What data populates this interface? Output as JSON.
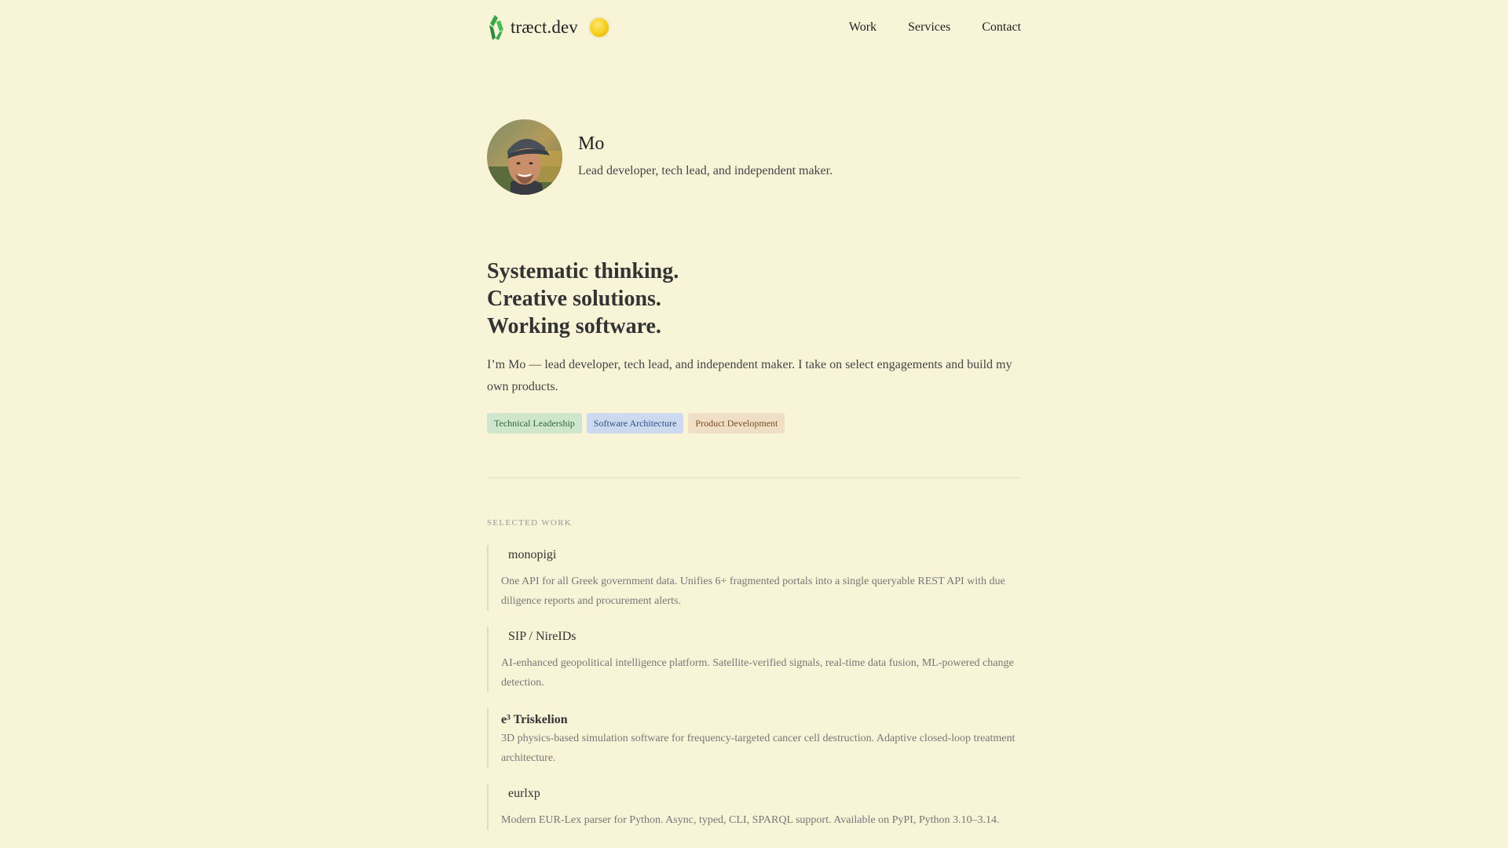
{
  "header": {
    "brand_name": "træct.dev",
    "nav": [
      "Work",
      "Services",
      "Contact"
    ]
  },
  "profile": {
    "name": "Mo",
    "tagline": "Lead developer, tech lead, and independent maker."
  },
  "hero": {
    "headline": [
      "Systematic thinking.",
      "Creative solutions.",
      "Working software."
    ],
    "intro": "I’m Mo — lead developer, tech lead, and independent maker. I take on select engagements and build my own products.",
    "tags": [
      "Technical Leadership",
      "Software Architecture",
      "Product Development"
    ]
  },
  "work": {
    "label": "SELECTED WORK",
    "items": [
      {
        "title": "monopigi",
        "desc": "One API for all Greek government data. Unifies 6+ fragmented portals into a single queryable REST API with due diligence reports and procurement alerts."
      },
      {
        "title": "SIP / NireIDs",
        "desc": "AI-enhanced geopolitical intelligence platform. Satellite-verified signals, real-time data fusion, ML-powered change detection."
      },
      {
        "title": "e³ Triskelion",
        "desc": "3D physics-based simulation software for frequency-targeted cancer cell destruction. Adaptive closed-loop treatment architecture."
      },
      {
        "title": "eurlxp",
        "desc": "Modern EUR-Lex parser for Python. Async, typed, CLI, SPARQL support. Available on PyPI, Python 3.10–3.14."
      }
    ]
  },
  "colors": {
    "background": "#f8f4d8",
    "logo_green": "#3aa54a",
    "toggle_yellow": "#f5cf1c"
  }
}
